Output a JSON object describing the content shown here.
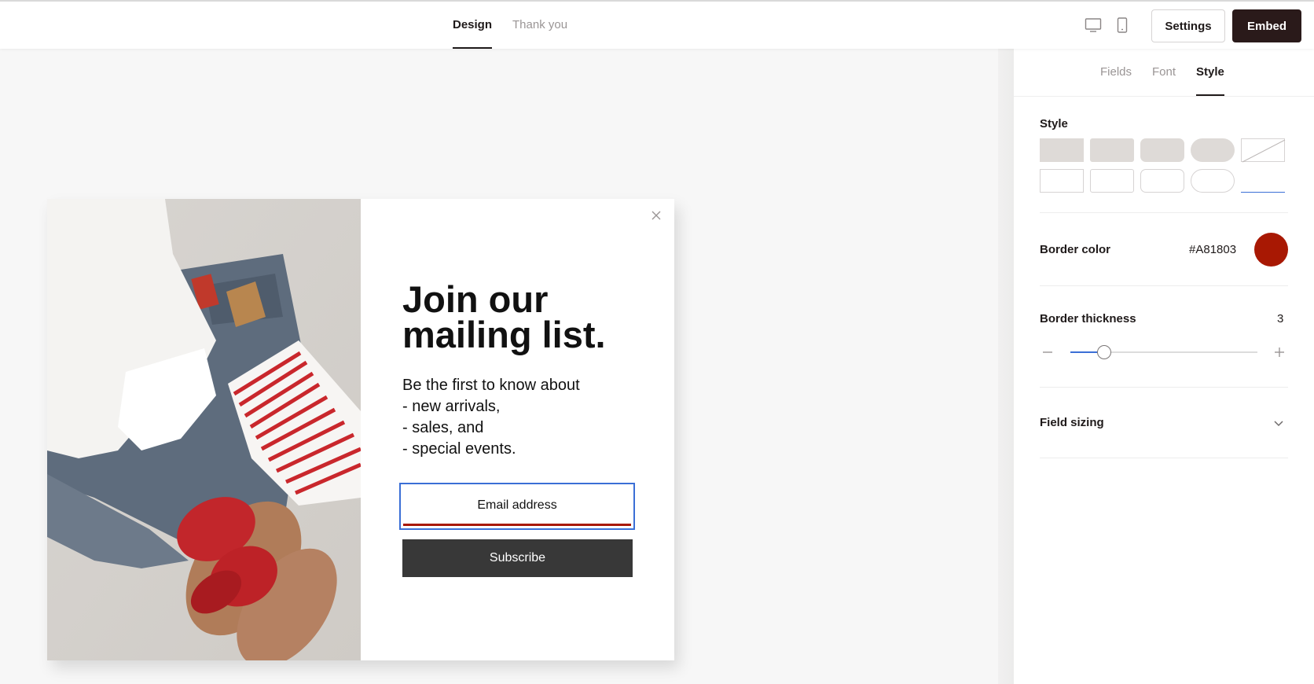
{
  "header": {
    "tabs": [
      {
        "label": "Design",
        "active": true
      },
      {
        "label": "Thank you",
        "active": false
      }
    ],
    "device_icons": [
      "desktop-icon",
      "mobile-icon"
    ],
    "settings_label": "Settings",
    "embed_label": "Embed"
  },
  "popup": {
    "headline_line1": "Join our",
    "headline_line2": "mailing list.",
    "body_lines": [
      "Be the first to know about",
      "- new arrivals,",
      "- sales, and",
      "- special events."
    ],
    "email_placeholder": "Email address",
    "subscribe_label": "Subscribe"
  },
  "panel": {
    "tabs": [
      {
        "label": "Fields",
        "active": false
      },
      {
        "label": "Font",
        "active": false
      },
      {
        "label": "Style",
        "active": true
      }
    ],
    "style_label": "Style",
    "border_color_label": "Border color",
    "border_color_hex": "#A81803",
    "border_thickness_label": "Border thickness",
    "border_thickness_value": "3",
    "border_thickness_fraction": 0.18,
    "field_sizing_label": "Field sizing"
  },
  "colors": {
    "accent_blue": "#3b6fd6",
    "border_color": "#A81803",
    "embed_button": "#2a1a1a",
    "subscribe_button": "#383838"
  }
}
